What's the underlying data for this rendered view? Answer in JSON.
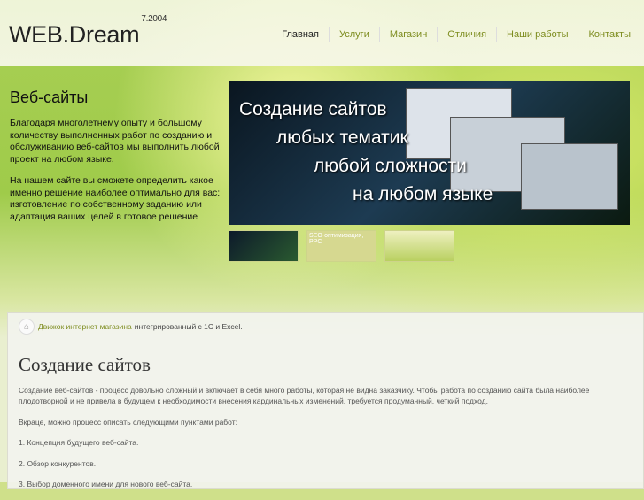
{
  "header": {
    "logo": "WEB.Dream",
    "logo_sup": "7.2004",
    "nav": [
      "Главная",
      "Услуги",
      "Магазин",
      "Отличия",
      "Наши работы",
      "Контакты"
    ]
  },
  "intro": {
    "title": "Веб-сайты",
    "p1": "Благодаря многолетнему опыту и большому количеству выполненных работ по созданию и обслуживанию веб-сайтов мы выполнить любой проект на любом языке.",
    "p2": "На нашем сайте вы сможете определить какое именно решение наиболее оптимально для вас: изготовление по собственному заданию или адаптация ваших целей в готовое решение"
  },
  "banner": {
    "lines": [
      "Создание сайтов",
      "любых тематик",
      "любой сложности",
      "на любом языке"
    ]
  },
  "thumbs": [
    "",
    "SEO-оптимизация, PPC",
    ""
  ],
  "breadcrumb": {
    "link": "Движок интернет магазина",
    "text": "интегрированный с 1С и Excel."
  },
  "content": {
    "title": "Создание сайтов",
    "paragraphs": [
      "Создание веб-сайтов - процесс довольно сложный и включает в себя много работы, которая не видна заказчику. Чтобы работа по созданию сайта была наиболее плодотворной и не привела в будущем к необходимости внесения кардинальных изменений, требуется продуманный, четкий подход.",
      "Вкраце, можно процесс описать следующими пунктами работ:",
      "1. Концепция будущего веб-сайта.",
      "2. Обзор конкурентов.",
      "3. Выбор доменного имени для нового веб-сайта."
    ]
  }
}
